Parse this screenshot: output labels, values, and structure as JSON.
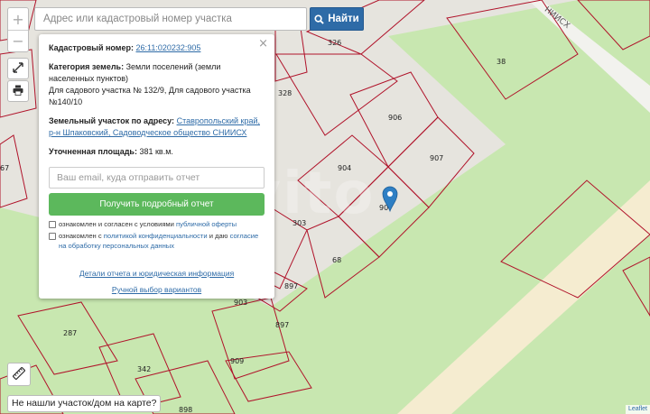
{
  "search": {
    "placeholder": "Адрес или кадастровый номер участка",
    "button_label": "Найти"
  },
  "zoom": {
    "in_label": "+",
    "out_label": "−"
  },
  "card": {
    "close_label": "×",
    "cadastral_label": "Кадастровый номер:",
    "cadastral_number": "26:11:020232:905",
    "category_label": "Категория земель:",
    "category_value": "Земли поселений (земли населенных пунктов)",
    "use_value": "Для садового участка № 132/9, Для садового участка №140/10",
    "address_label": "Земельный участок по адресу:",
    "address_value": "Ставропольский край, р-н Шпаковский, Садоводческое общество СНИИСХ",
    "area_label": "Уточненная площадь:",
    "area_value": "381 кв.м.",
    "email_placeholder": "Ваш email, куда отправить отчет",
    "report_button": "Получить подробный отчет",
    "consent1_text": "ознакомлен и согласен с условиями",
    "consent1_link": "публичной оферты",
    "consent2_text": "ознакомлен с",
    "consent2_link1": "политикой конфиденциальности",
    "consent2_mid": "и даю",
    "consent2_link2": "согласие на обработку персональных данных",
    "details_link": "Детали отчета и юридическая информация",
    "manual_link": "Ручной выбор вариантов"
  },
  "map": {
    "street_label": "НИИСХ",
    "watermark": "Avito",
    "attribution": "Leaflet",
    "plot_labels": [
      "326",
      "38",
      "328",
      "906",
      "907",
      "904",
      "90",
      "303",
      "68",
      "897",
      "897",
      "903",
      "287",
      "342",
      "909",
      "898",
      "67"
    ],
    "colors": {
      "background": "#e6e4de",
      "green": "#c8e7b0",
      "road": "#f5ecd0",
      "boundary": "#b0132a",
      "pin": "#2e7fc4"
    }
  },
  "buttons": {
    "not_found": "Не нашли участок/дом на карте?"
  },
  "icons": {
    "search": "search-icon",
    "expand": "expand-icon",
    "print": "print-icon",
    "ruler": "ruler-icon",
    "pin": "map-pin-icon"
  }
}
